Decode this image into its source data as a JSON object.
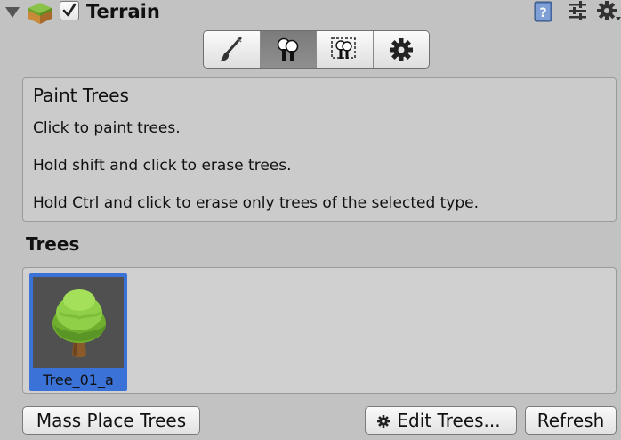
{
  "header": {
    "title": "Terrain",
    "enabled": true,
    "icons": [
      "foldout-arrow-icon",
      "terrain-component-icon",
      "help-book-icon",
      "presets-sliders-icon",
      "gear-icon"
    ]
  },
  "toolbar": {
    "tools": [
      {
        "name": "paint-brush-icon",
        "active": false
      },
      {
        "name": "paint-trees-icon",
        "active": true
      },
      {
        "name": "paint-details-icon",
        "active": false
      },
      {
        "name": "settings-gear-icon",
        "active": false
      }
    ]
  },
  "help": {
    "title": "Paint Trees",
    "lines": [
      "Click to paint trees.",
      "Hold shift and click to erase trees.",
      "Hold Ctrl and click to erase only trees of the selected type."
    ]
  },
  "trees": {
    "label": "Trees",
    "items": [
      {
        "name": "Tree_01_a",
        "selected": true
      }
    ]
  },
  "buttons": {
    "mass_place": "Mass Place Trees",
    "edit_trees": "Edit Trees...",
    "refresh": "Refresh"
  },
  "colors": {
    "background": "#c2c2c2",
    "selection": "#3a72d8",
    "active_tool": "#858585"
  }
}
